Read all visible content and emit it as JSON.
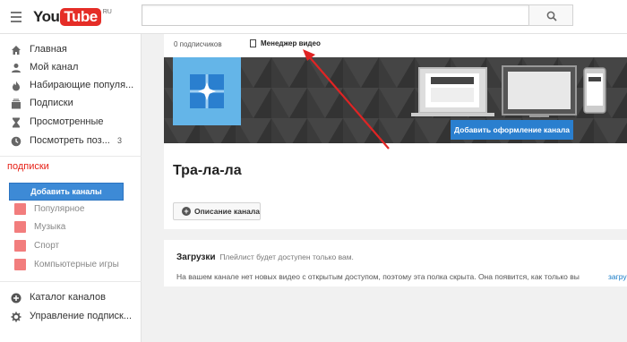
{
  "header": {
    "logo_you": "You",
    "logo_tube": "Tube",
    "logo_region": "RU",
    "search_placeholder": ""
  },
  "sidebar": {
    "items": [
      {
        "label": "Главная",
        "icon": "home-icon"
      },
      {
        "label": "Мой канал",
        "icon": "person-icon"
      },
      {
        "label": "Набирающие популя...",
        "icon": "flame-icon"
      },
      {
        "label": "Подписки",
        "icon": "subscriptions-icon"
      },
      {
        "label": "Просмотренные",
        "icon": "hourglass-icon"
      },
      {
        "label": "Посмотреть поз...",
        "icon": "clock-icon",
        "count": "3"
      }
    ],
    "subscriptions_title": "подписки",
    "add_channels_label": "Добавить каналы",
    "subscriptions": [
      {
        "label": "Популярное",
        "icon": "popular-icon"
      },
      {
        "label": "Музыка",
        "icon": "music-icon"
      },
      {
        "label": "Спорт",
        "icon": "sport-icon"
      },
      {
        "label": "Компьютерные игры",
        "icon": "games-icon"
      }
    ],
    "bottom_items": [
      {
        "label": "Каталог каналов",
        "icon": "plus-circle-icon"
      },
      {
        "label": "Управление подписк...",
        "icon": "gear-icon"
      }
    ]
  },
  "channel": {
    "subscribers": "0 подписчиков",
    "video_manager_label": "Менеджер видео",
    "add_art_label": "Добавить оформление канала",
    "name": "Тра-ла-ла",
    "description_button": "Описание канала"
  },
  "uploads": {
    "title": "Загрузки",
    "note": "Плейлист будет доступен только вам.",
    "body": "На вашем канале нет новых видео с открытым доступом, поэтому эта полка скрыта. Она появится, как только вы",
    "link": "загру"
  },
  "colors": {
    "accent_blue": "#2a7fcf",
    "red": "#e52d27",
    "arrow": "#e02424"
  }
}
